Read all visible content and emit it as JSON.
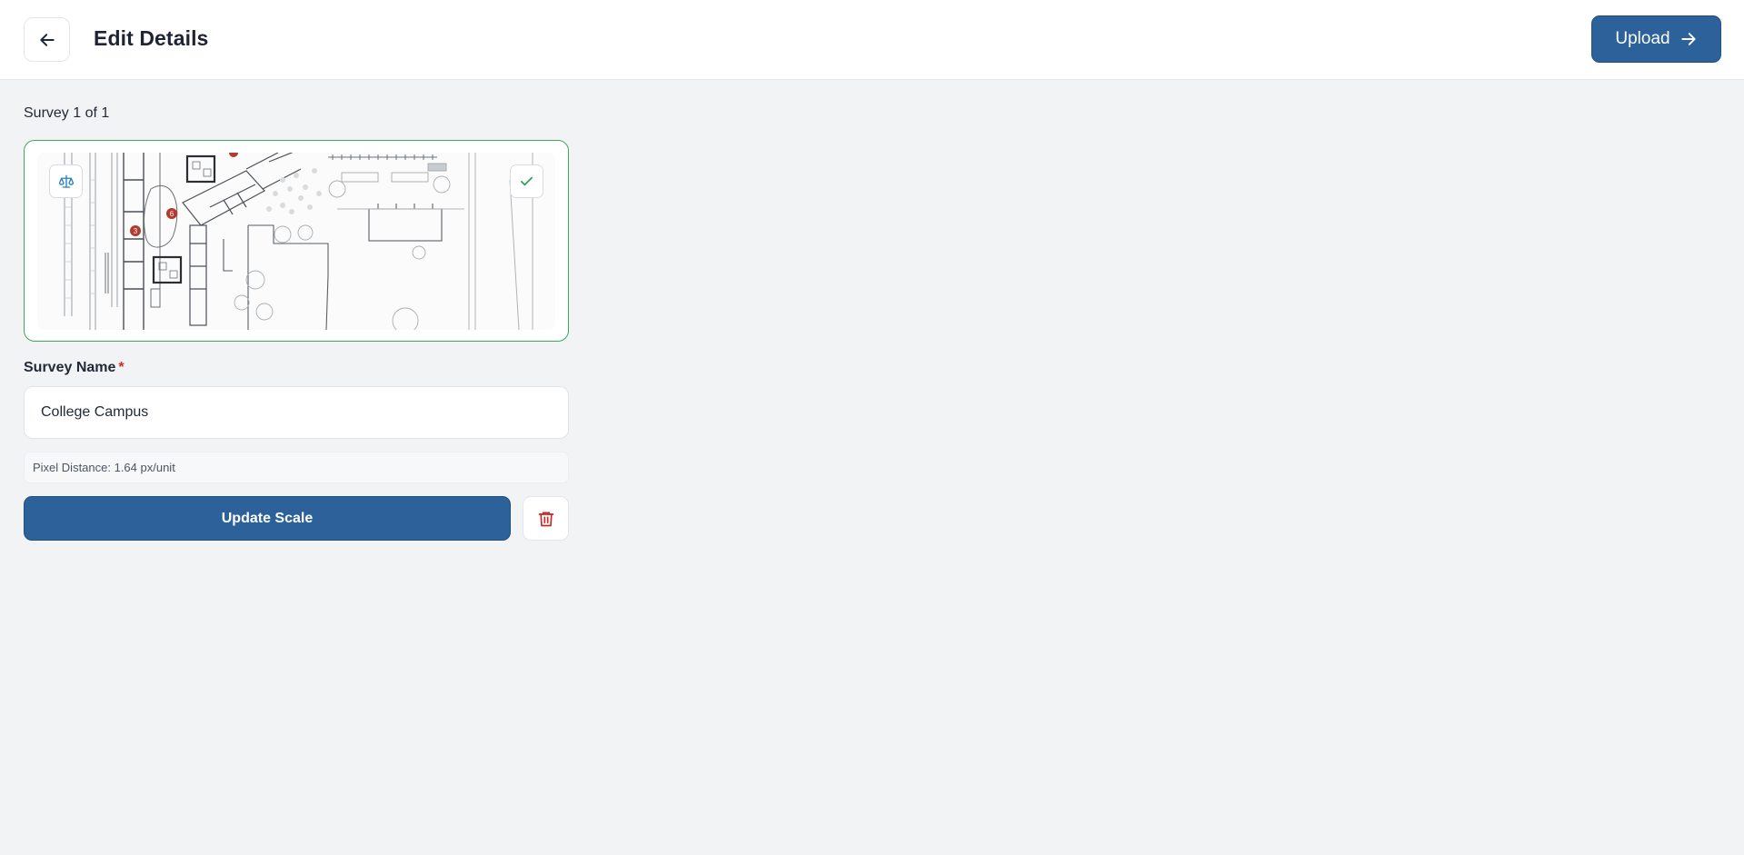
{
  "header": {
    "title": "Edit Details",
    "back_icon": "arrow-left-icon",
    "upload_label": "Upload",
    "upload_icon": "arrow-right-icon"
  },
  "survey": {
    "counter": "Survey 1 of 1",
    "preview": {
      "scale_icon": "scale-balance-icon",
      "selected_icon": "check-icon",
      "markers": [
        "6",
        "3"
      ]
    }
  },
  "form": {
    "name_label": "Survey Name",
    "required_mark": "*",
    "name_value": "College Campus",
    "pixel_distance": "Pixel Distance: 1.64 px/unit",
    "update_label": "Update Scale",
    "delete_icon": "trash-icon"
  },
  "colors": {
    "primary": "#2c6199",
    "selected_border": "#3aa95a",
    "danger": "#c62828",
    "page_bg": "#f2f3f5"
  }
}
